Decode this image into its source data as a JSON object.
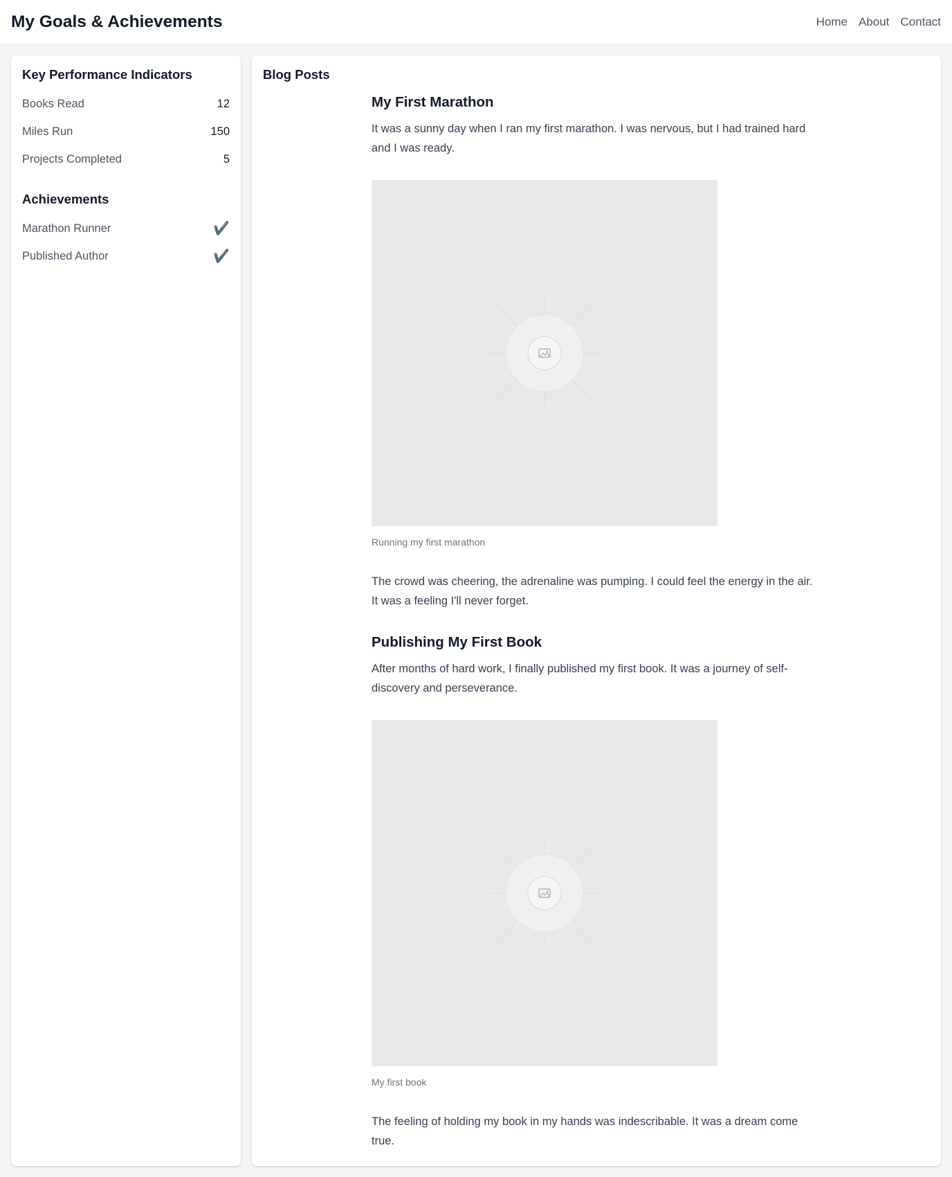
{
  "header": {
    "title": "My Goals & Achievements",
    "nav": [
      "Home",
      "About",
      "Contact"
    ]
  },
  "sidebar": {
    "kpi_heading": "Key Performance Indicators",
    "kpis": [
      {
        "label": "Books Read",
        "value": "12"
      },
      {
        "label": "Miles Run",
        "value": "150"
      },
      {
        "label": "Projects Completed",
        "value": "5"
      }
    ],
    "achievements_heading": "Achievements",
    "achievements": [
      {
        "label": "Marathon Runner",
        "icon": "check-icon",
        "mark": "✔️"
      },
      {
        "label": "Published Author",
        "icon": "check-icon",
        "mark": "✔️"
      }
    ]
  },
  "blog": {
    "heading": "Blog Posts",
    "posts": [
      {
        "title": "My First Marathon",
        "intro": "It was a sunny day when I ran my first marathon. I was nervous, but I had trained hard and I was ready.",
        "image_icon": "image-placeholder-icon",
        "caption": "Running my first marathon",
        "after": "The crowd was cheering, the adrenaline was pumping. I could feel the energy in the air. It was a feeling I'll never forget."
      },
      {
        "title": "Publishing My First Book",
        "intro": "After months of hard work, I finally published my first book. It was a journey of self-discovery and perseverance.",
        "image_icon": "image-placeholder-icon",
        "caption": "My first book",
        "after": "The feeling of holding my book in my hands was indescribable. It was a dream come true."
      }
    ]
  }
}
